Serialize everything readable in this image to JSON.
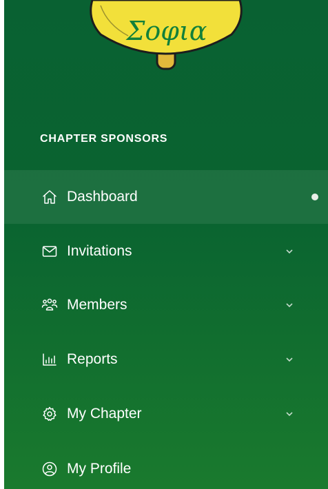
{
  "logo": {
    "text": "Σοφια"
  },
  "section": {
    "title": "CHAPTER SPONSORS"
  },
  "nav": {
    "items": [
      {
        "label": "Dashboard",
        "icon": "home-icon",
        "active": true
      },
      {
        "label": "Invitations",
        "icon": "envelope-icon",
        "expandable": true
      },
      {
        "label": "Members",
        "icon": "users-icon",
        "expandable": true
      },
      {
        "label": "Reports",
        "icon": "bar-chart-icon",
        "expandable": true
      },
      {
        "label": "My Chapter",
        "icon": "gear-icon",
        "expandable": true
      },
      {
        "label": "My Profile",
        "icon": "user-circle-icon"
      }
    ]
  },
  "colors": {
    "sidebar_bg": "#096132",
    "logo_yellow": "#f2e03a",
    "logo_gold": "#e2b93b"
  }
}
